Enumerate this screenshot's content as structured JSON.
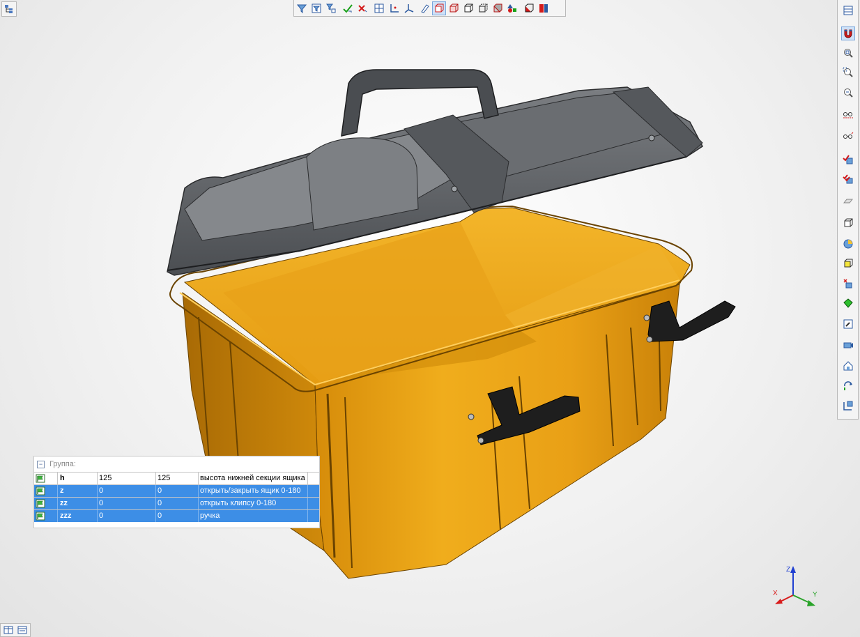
{
  "params_panel": {
    "group_label": "Группа:",
    "collapse_symbol": "−",
    "rows": [
      {
        "name": "h",
        "value": "125",
        "expression": "125",
        "comment": "высота нижней секции ящика",
        "selected": false
      },
      {
        "name": "z",
        "value": "0",
        "expression": "0",
        "comment": "открыть/закрыть ящик 0-180",
        "selected": true
      },
      {
        "name": "zz",
        "value": "0",
        "expression": "0",
        "comment": "открыть клипсу 0-180",
        "selected": true
      },
      {
        "name": "zzz",
        "value": "0",
        "expression": "0",
        "comment": "ручка",
        "selected": true
      }
    ]
  },
  "triad": {
    "x_label": "X",
    "y_label": "Y",
    "z_label": "Z",
    "x_color": "#d81b1b",
    "y_color": "#2aa32a",
    "z_color": "#1f3fd1"
  },
  "colors": {
    "box_body": "#eda516",
    "box_shadow": "#b9780a",
    "lid": "#616468",
    "lid_dark": "#3c3e41",
    "handles": "#1e1e1e",
    "selection": "#3d8ee6"
  },
  "toolbar_top_icons": [
    "filter-icon",
    "filter-list-icon",
    "filter-tree-icon",
    "check-select-icon",
    "cross-select-icon",
    "layout-icon",
    "axis-2d-icon",
    "axis-3d-icon",
    "sketch-icon",
    "box-wire-icon",
    "box-red-icon",
    "box-solid-icon",
    "box-hidden-icon",
    "box-shaded-icon",
    "shapes-icon",
    "cube-red-icon",
    "coords-icon"
  ],
  "toolbar_right_icons": [
    "window-icon",
    "magnet-icon",
    "zoom-fit-icon",
    "zoom-window-icon",
    "zoom-out-icon",
    "glasses-icon",
    "glasses-line-icon",
    "check-cube-icon",
    "check-multi-cube-icon",
    "plane-icon",
    "cube-edges-icon",
    "sphere-icon",
    "cube-yellow-icon",
    "cube-cross-icon",
    "cube-green-icon",
    "wrench-icon",
    "camera-icon",
    "home-icon",
    "rotate-icon",
    "save-view-icon"
  ]
}
